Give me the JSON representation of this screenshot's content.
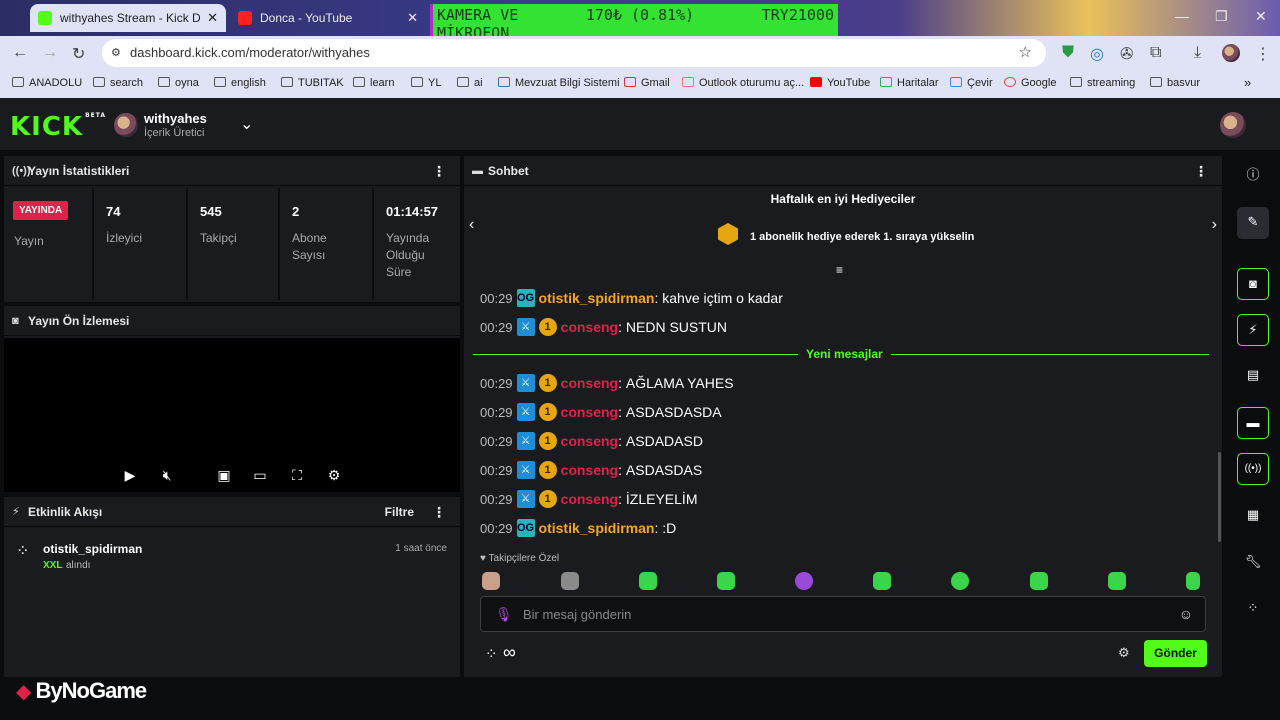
{
  "browser": {
    "tabs": [
      {
        "title": "withyahes Stream - Kick Dashbo",
        "active": true
      },
      {
        "title": "Donca - YouTube",
        "active": false
      }
    ],
    "url": "dashboard.kick.com/moderator/withyahes",
    "bookmarks": [
      "ANADOLU",
      "search",
      "oyna",
      "english",
      "TUBITAK",
      "learn",
      "YL",
      "ai",
      "Mevzuat Bilgi Sistemi",
      "Gmail",
      "Outlook oturumu aç...",
      "YouTube",
      "Haritalar",
      "Çevir",
      "Google",
      "streaming",
      "basvur"
    ]
  },
  "overlay": {
    "line1_left": "KAMERA VE",
    "line1_mid": "170₺ (0.81%)",
    "line1_right": "TRY21000",
    "line2": "MİKROFON"
  },
  "header": {
    "logo": "KICK",
    "logo_badge": "BETA",
    "username": "withyahes",
    "role": "İçerik Üretici"
  },
  "stats": {
    "title": "Yayın İstatistikleri",
    "live_badge": "YAYINDA",
    "live_label": "Yayın",
    "viewers": "74",
    "viewers_label": "İzleyici",
    "followers": "545",
    "followers_label": "Takipçi",
    "subs": "2",
    "subs_label": "Abone Sayısı",
    "uptime": "01:14:57",
    "uptime_label": "Yayında Olduğu Süre"
  },
  "preview": {
    "title": "Yayın Ön İzlemesi"
  },
  "activity": {
    "title": "Etkinlik Akışı",
    "filter": "Filtre",
    "items": [
      {
        "user": "otistik_spidirman",
        "highlight": "XXL",
        "action": "alındı",
        "time": "1 saat önce"
      }
    ]
  },
  "chat": {
    "title": "Sohbet",
    "gifters_title": "Haftalık en iyi Hediyeciler",
    "gifters_text": "1 abonelik hediye ederek 1. sıraya yükselin",
    "new_messages": "Yeni mesajlar",
    "messages": [
      {
        "time": "00:29",
        "user": "otistik_spidirman",
        "text": "kahve içtim o kadar",
        "color": "#f5a623"
      },
      {
        "time": "00:29",
        "user": "conseng",
        "text": "NEDN SUSTUN",
        "color": "#e0214a"
      },
      {
        "time": "00:29",
        "user": "conseng",
        "text": "AĞLAMA YAHES",
        "color": "#e0214a"
      },
      {
        "time": "00:29",
        "user": "conseng",
        "text": "ASDASDASDA",
        "color": "#e0214a"
      },
      {
        "time": "00:29",
        "user": "conseng",
        "text": "ASDADASD",
        "color": "#e0214a"
      },
      {
        "time": "00:29",
        "user": "conseng",
        "text": "ASDASDAS",
        "color": "#e0214a"
      },
      {
        "time": "00:29",
        "user": "conseng",
        "text": "İZLEYELİM",
        "color": "#e0214a"
      },
      {
        "time": "00:29",
        "user": "otistik_spidirman",
        "text": ":D",
        "color": "#f5a623"
      }
    ],
    "followers_only": "Takipçilere Özel",
    "input_placeholder": "Bir mesaj gönderin",
    "infinity": "∞",
    "send": "Gönder"
  },
  "watermark": "ByNoGame",
  "colors": {
    "kick_green": "#53fc18",
    "panel": "#191b1f",
    "bg": "#0b0c0d",
    "live_red": "#e0214a"
  }
}
